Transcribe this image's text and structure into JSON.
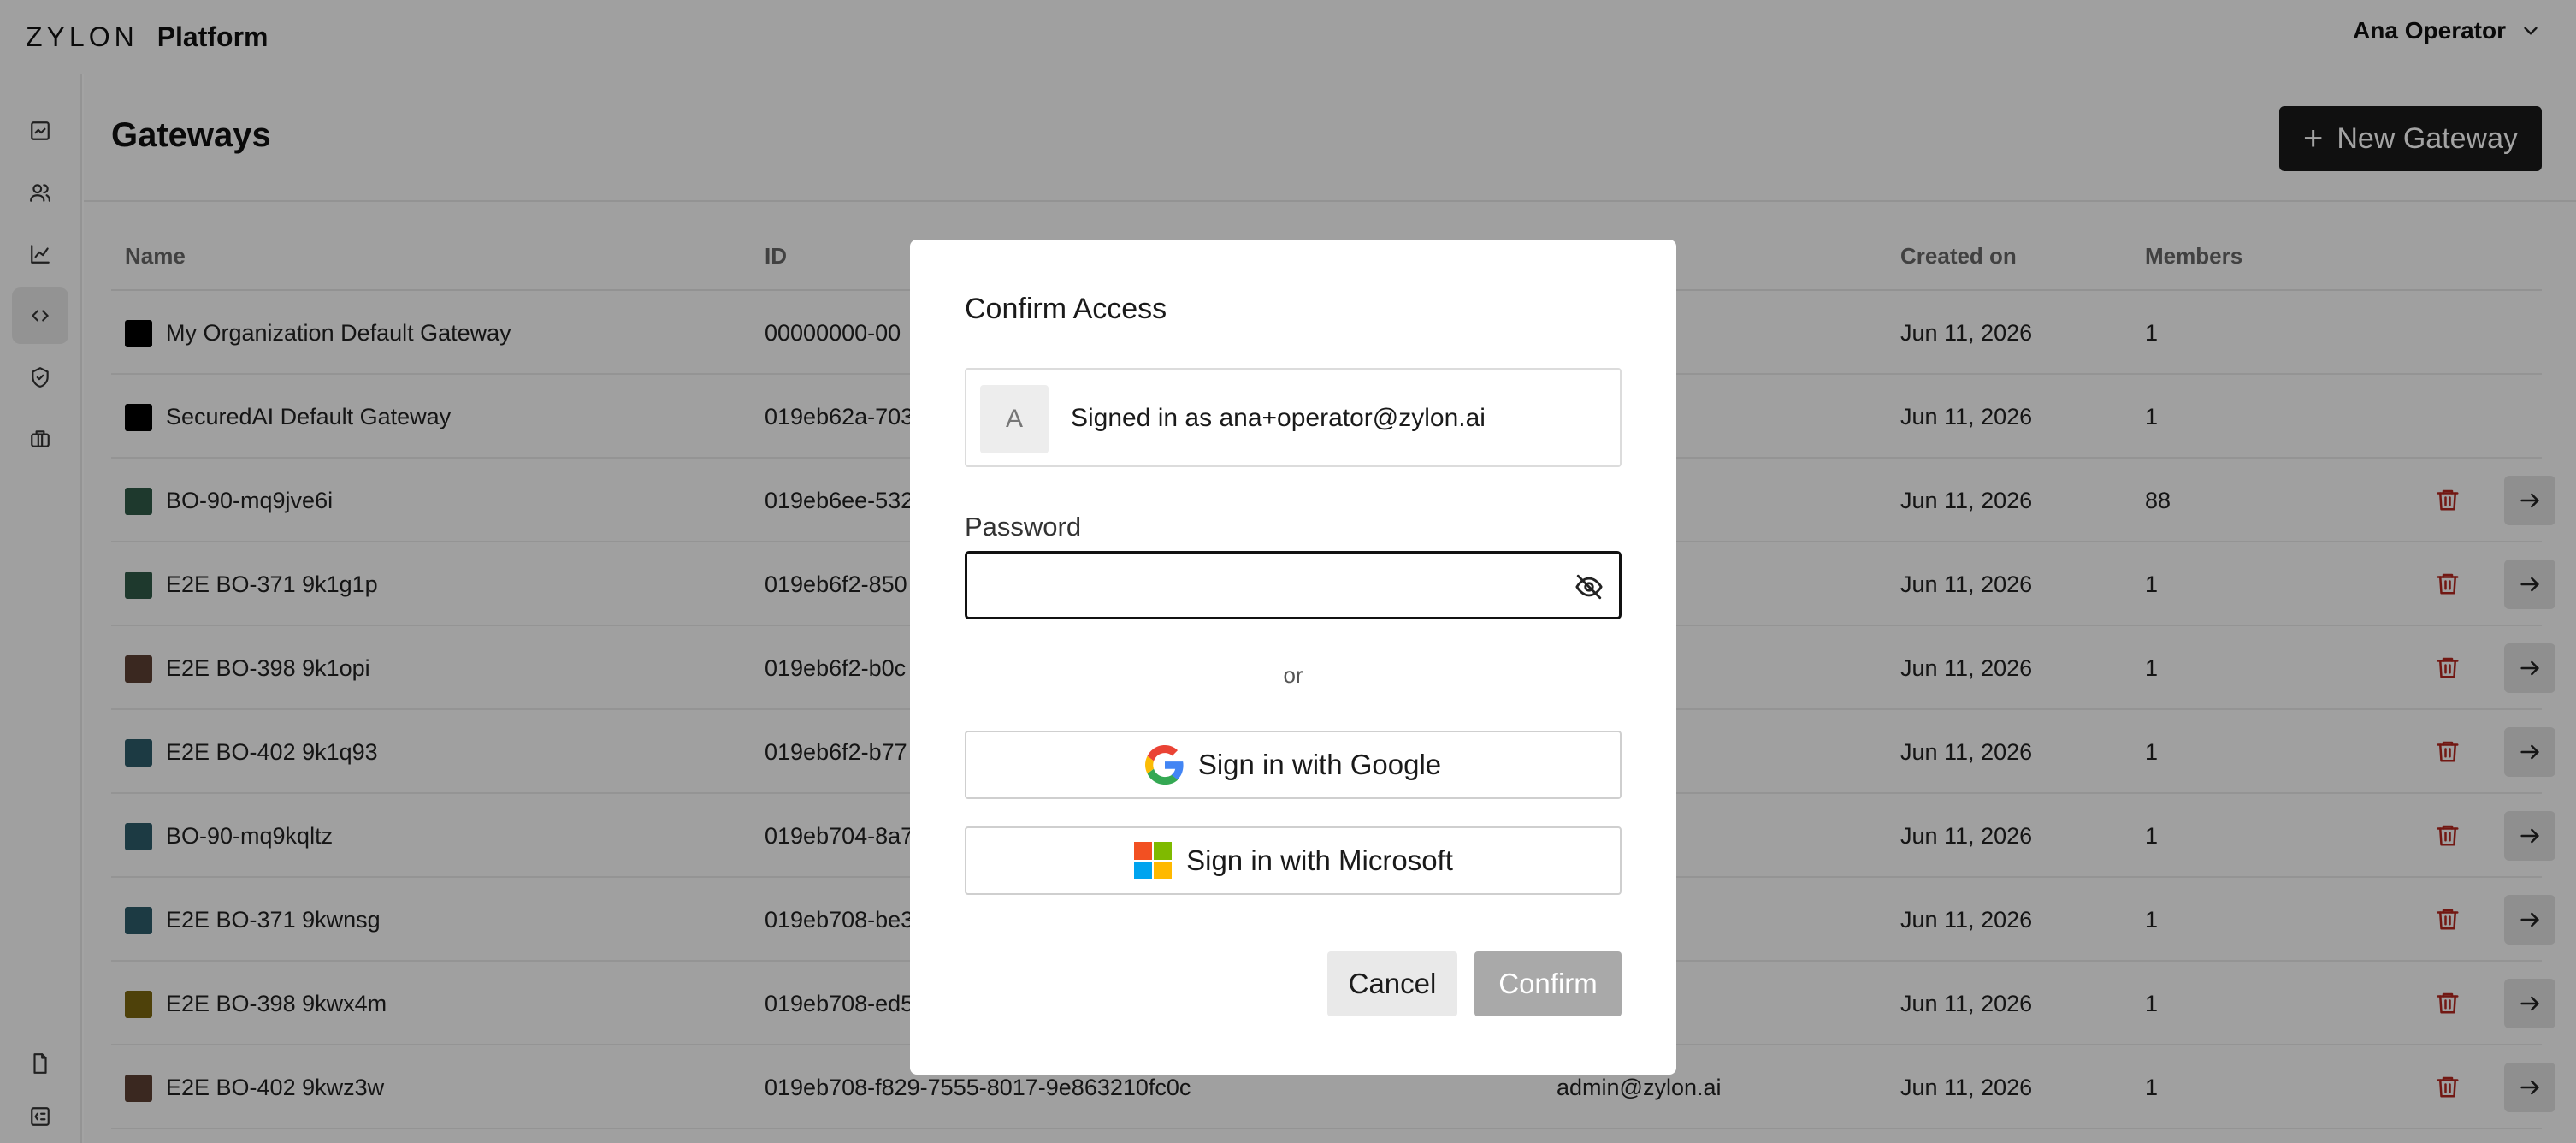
{
  "header": {
    "logo": "ZYLON",
    "product": "Platform",
    "user_name": "Ana Operator"
  },
  "sidebar": {
    "items": [
      {
        "icon": "dashboard-icon",
        "active": false
      },
      {
        "icon": "users-icon",
        "active": false
      },
      {
        "icon": "chart-icon",
        "active": false
      },
      {
        "icon": "code-icon",
        "active": true
      },
      {
        "icon": "shield-icon",
        "active": false
      },
      {
        "icon": "briefcase-icon",
        "active": false
      },
      {
        "icon": "document-icon",
        "active": false
      },
      {
        "icon": "panel-icon",
        "active": false
      }
    ]
  },
  "page": {
    "title": "Gateways",
    "new_button": "New Gateway"
  },
  "table": {
    "columns": {
      "name": "Name",
      "id": "ID",
      "created": "Created on",
      "members": "Members"
    },
    "rows": [
      {
        "color": "#000000",
        "name": "My Organization Default Gateway",
        "id": "00000000-00",
        "created_by": "",
        "created": "Jun 11, 2026",
        "members": "1",
        "actions": false
      },
      {
        "color": "#000000",
        "name": "SecuredAI Default Gateway",
        "id": "019eb62a-703",
        "created_by": "",
        "created": "Jun 11, 2026",
        "members": "1",
        "actions": false
      },
      {
        "color": "#2f5a47",
        "name": "BO-90-mq9jve6i",
        "id": "019eb6ee-532",
        "created_by": "",
        "created": "Jun 11, 2026",
        "members": "88",
        "actions": true
      },
      {
        "color": "#2f5a47",
        "name": "E2E BO-371 9k1g1p",
        "id": "019eb6f2-850",
        "created_by": "",
        "created": "Jun 11, 2026",
        "members": "1",
        "actions": true
      },
      {
        "color": "#5c3f33",
        "name": "E2E BO-398 9k1opi",
        "id": "019eb6f2-b0c",
        "created_by": "",
        "created": "Jun 11, 2026",
        "members": "1",
        "actions": true
      },
      {
        "color": "#2d5b6a",
        "name": "E2E BO-402 9k1q93",
        "id": "019eb6f2-b77",
        "created_by": "",
        "created": "Jun 11, 2026",
        "members": "1",
        "actions": true
      },
      {
        "color": "#2d5b6a",
        "name": "BO-90-mq9kqltz",
        "id": "019eb704-8a7",
        "created_by": "",
        "created": "Jun 11, 2026",
        "members": "1",
        "actions": true
      },
      {
        "color": "#2d5b6a",
        "name": "E2E BO-371 9kwnsg",
        "id": "019eb708-be3",
        "created_by": "",
        "created": "Jun 11, 2026",
        "members": "1",
        "actions": true
      },
      {
        "color": "#7a6611",
        "name": "E2E BO-398 9kwx4m",
        "id": "019eb708-ed5",
        "created_by": "",
        "created": "Jun 11, 2026",
        "members": "1",
        "actions": true
      },
      {
        "color": "#5c3f33",
        "name": "E2E BO-402 9kwz3w",
        "id": "019eb708-f829-7555-8017-9e863210fc0c",
        "created_by": "admin@zylon.ai",
        "created": "Jun 11, 2026",
        "members": "1",
        "actions": true
      }
    ]
  },
  "modal": {
    "title": "Confirm Access",
    "avatar_letter": "A",
    "signed_in_text": "Signed in as ana+operator@zylon.ai",
    "password_label": "Password",
    "password_value": "",
    "or_text": "or",
    "google_label": "Sign in with Google",
    "microsoft_label": "Sign in with Microsoft",
    "cancel_label": "Cancel",
    "confirm_label": "Confirm"
  },
  "colors": {
    "accent_dark": "#1a1a1a",
    "delete_red": "#b3261e",
    "confirm_disabled": "#a9a9a9"
  }
}
